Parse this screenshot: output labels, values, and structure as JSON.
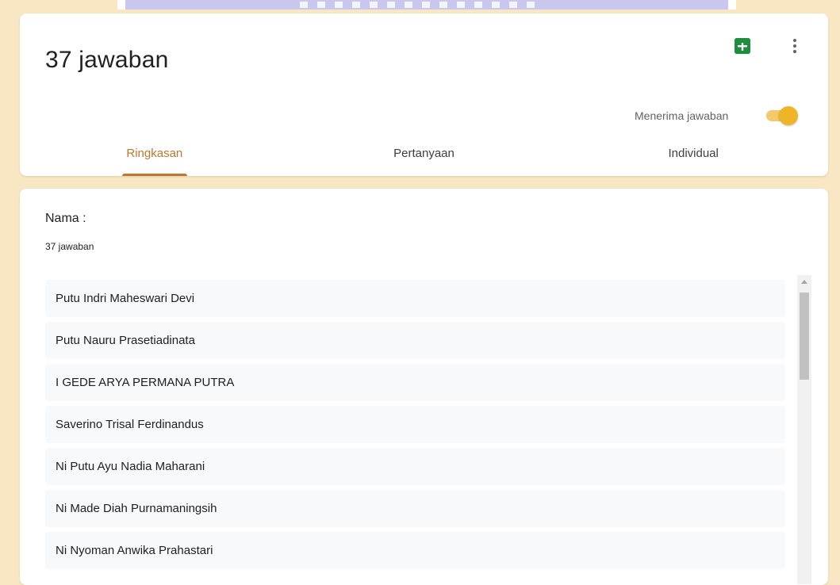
{
  "header": {
    "title": "37 jawaban",
    "accepting_label": "Menerima jawaban",
    "accepting_on": true,
    "sheets_icon": "google-sheets-icon",
    "more_icon": "more-vert-icon"
  },
  "tabs": [
    {
      "label": "Ringkasan",
      "active": true
    },
    {
      "label": "Pertanyaan",
      "active": false
    },
    {
      "label": "Individual",
      "active": false
    }
  ],
  "question": {
    "title": "Nama :",
    "count": "37 jawaban",
    "responses": [
      "Putu Indri Maheswari Devi",
      "Putu Nauru Prasetiadinata",
      "I GEDE ARYA PERMANA PUTRA",
      "Saverino Trisal Ferdinandus",
      "Ni Putu Ayu Nadia Maharani",
      "Ni Made Diah Purnamaningsih",
      "Ni Nyoman Anwika Prahastari"
    ]
  },
  "colors": {
    "background": "#f9e6c2",
    "accent": "#c0762c",
    "toggle": "#f0b429",
    "sheets_green": "#1e8e3e"
  }
}
